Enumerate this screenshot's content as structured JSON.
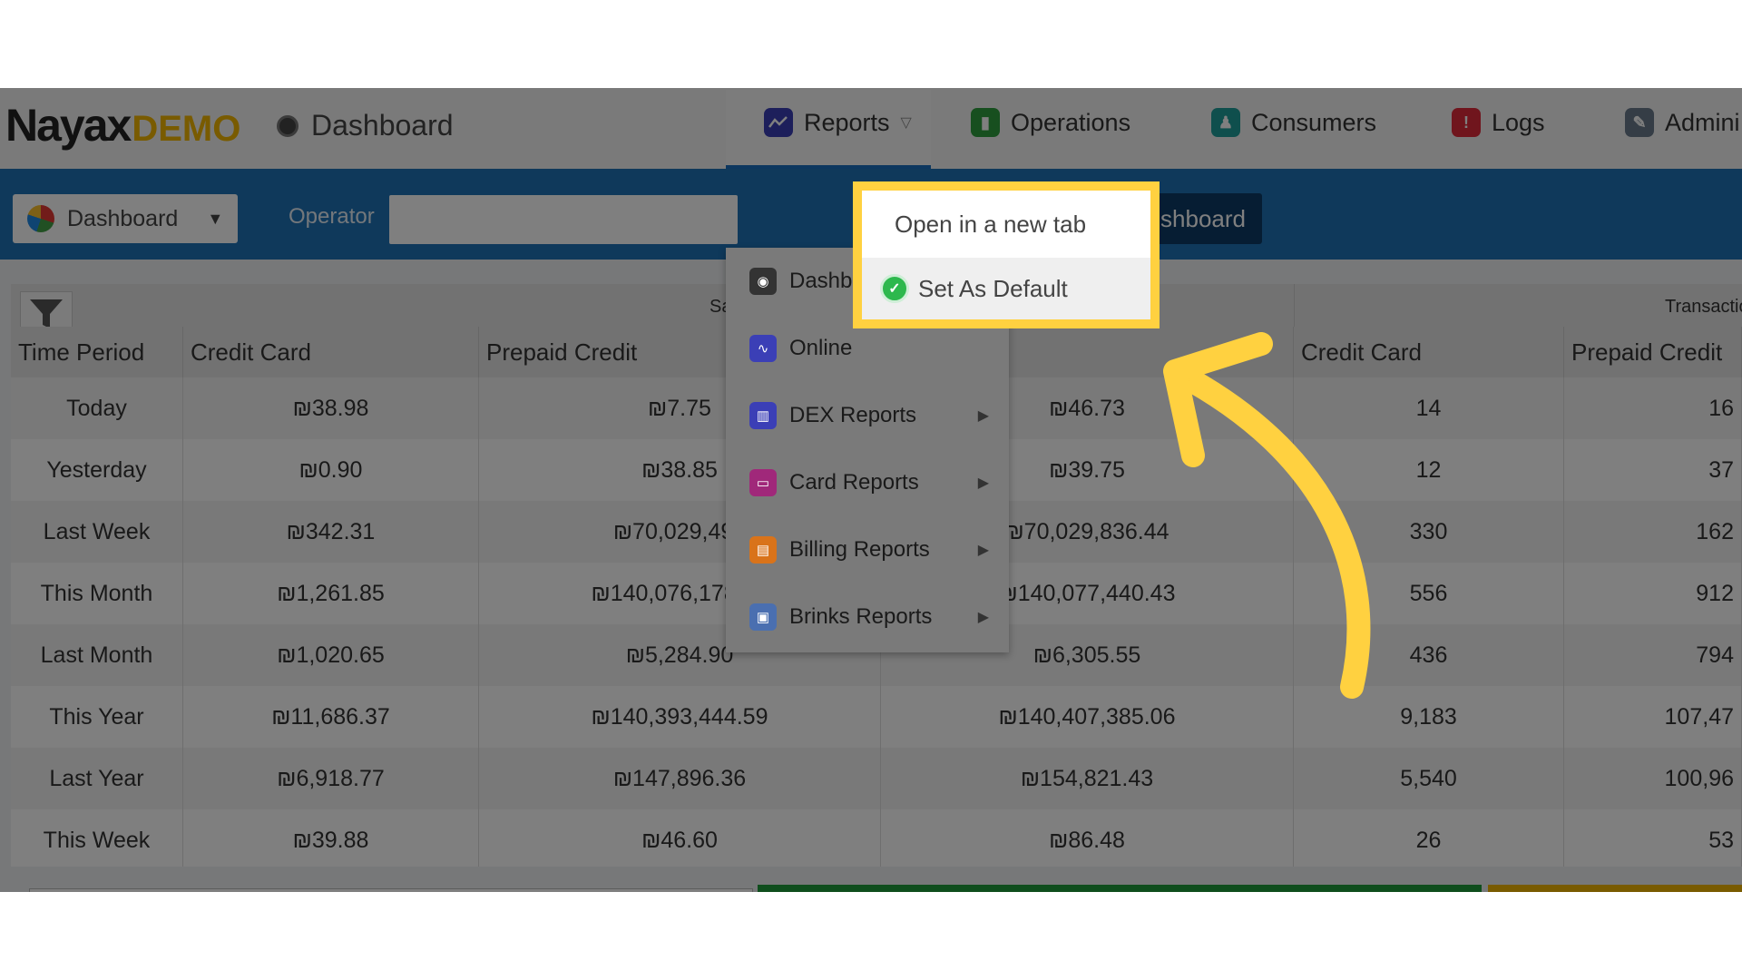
{
  "header": {
    "logo_main": "Nayax",
    "logo_sub": "DEMO",
    "page_title": "Dashboard",
    "nav": [
      {
        "label": "Reports",
        "icon": "chart-line-icon",
        "color": "#3b3fb6"
      },
      {
        "label": "Operations",
        "icon": "clipboard-icon",
        "color": "#2e9e3e"
      },
      {
        "label": "Consumers",
        "icon": "users-icon",
        "color": "#1f9e9a"
      },
      {
        "label": "Logs",
        "icon": "alert-icon",
        "color": "#e02a3a"
      },
      {
        "label": "Admini",
        "icon": "wrench-icon",
        "color": "#6b7b8c"
      }
    ]
  },
  "toolbar": {
    "dashboard_select": "Dashboard",
    "operator_label": "Operator",
    "operator_value": "",
    "dashboard_button": "shboard"
  },
  "reports_menu": {
    "items": [
      {
        "label": "Dashb",
        "icon": "dashboard-icon",
        "has_arrow": false,
        "color": "#333333"
      },
      {
        "label": "Online",
        "icon": "chart-line-icon",
        "has_arrow": false,
        "color": "#3b3fb6"
      },
      {
        "label": "DEX Reports",
        "icon": "bar-chart-icon",
        "has_arrow": true,
        "color": "#3b3fb6"
      },
      {
        "label": "Card Reports",
        "icon": "card-icon",
        "has_arrow": true,
        "color": "#a0287a"
      },
      {
        "label": "Billing Reports",
        "icon": "billing-icon",
        "has_arrow": true,
        "color": "#d9731a"
      },
      {
        "label": "Brinks Reports",
        "icon": "brinks-icon",
        "has_arrow": true,
        "color": "#4a6fb0"
      }
    ]
  },
  "context_menu": {
    "open_new_tab": "Open in a new tab",
    "set_default": "Set As Default"
  },
  "table": {
    "group_headers": [
      "Sa",
      "Transactio"
    ],
    "columns": [
      "Time Period",
      "Credit Card",
      "Prepaid Credit",
      "",
      "Credit Card",
      "Prepaid Credit"
    ],
    "rows": [
      [
        "Today",
        "₪38.98",
        "₪7.75",
        "₪46.73",
        "14",
        "16"
      ],
      [
        "Yesterday",
        "₪0.90",
        "₪38.85",
        "₪39.75",
        "12",
        "37"
      ],
      [
        "Last Week",
        "₪342.31",
        "₪70,029,494",
        "₪70,029,836.44",
        "330",
        "162"
      ],
      [
        "This Month",
        "₪1,261.85",
        "₪140,076,178.58",
        "₪140,077,440.43",
        "556",
        "912"
      ],
      [
        "Last Month",
        "₪1,020.65",
        "₪5,284.90",
        "₪6,305.55",
        "436",
        "794"
      ],
      [
        "This Year",
        "₪11,686.37",
        "₪140,393,444.59",
        "₪140,407,385.06",
        "9,183",
        "107,47"
      ],
      [
        "Last Year",
        "₪6,918.77",
        "₪147,896.36",
        "₪154,821.43",
        "5,540",
        "100,96"
      ],
      [
        "This Week",
        "₪39.88",
        "₪46.60",
        "₪86.48",
        "26",
        "53"
      ]
    ]
  }
}
